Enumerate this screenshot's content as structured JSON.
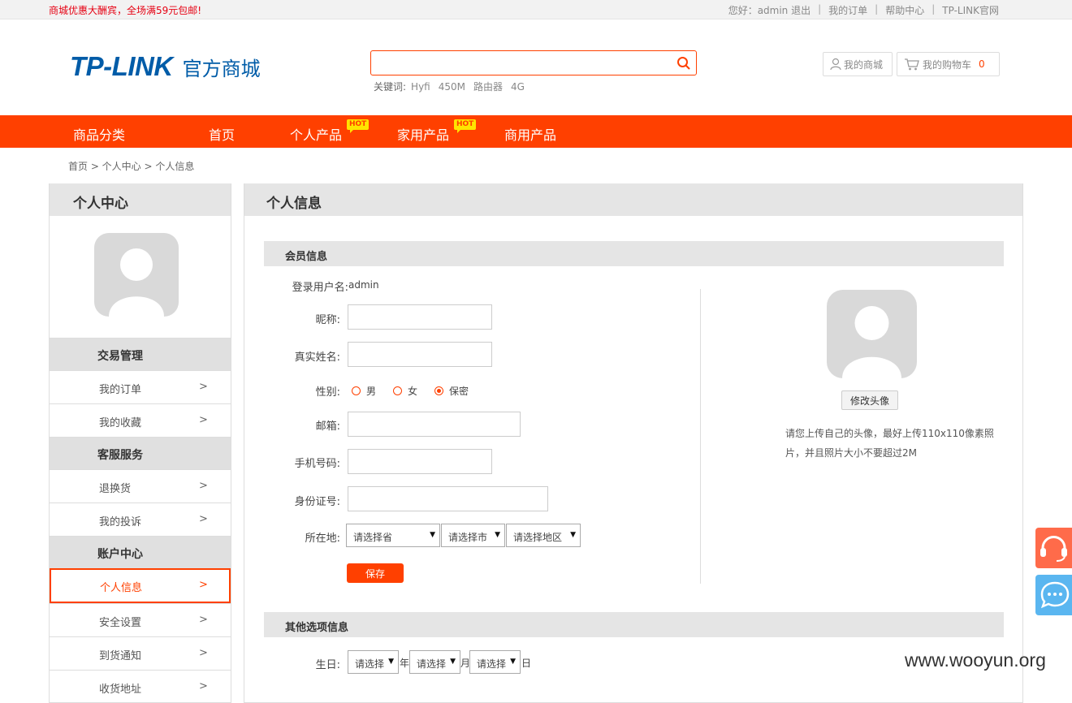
{
  "topbar": {
    "promo": "商城优惠大酬宾，全场满59元包邮!",
    "greeting": "您好：admin 退出",
    "links": [
      "我的订单",
      "帮助中心",
      "TP-LINK官网"
    ]
  },
  "header": {
    "logo_brand": "TP-LINK",
    "logo_sub": "官方商城",
    "search_value": "",
    "keywords_label": "关键词:",
    "keywords": [
      "Hyfi",
      "450M",
      "路由器",
      "4G"
    ],
    "my_mall": "我的商城",
    "cart_label": "我的购物车",
    "cart_count": "0"
  },
  "nav": {
    "items": [
      "商品分类",
      "首页",
      "个人产品",
      "家用产品",
      "商用产品"
    ],
    "hot_label": "HOT"
  },
  "breadcrumb": "首页 > 个人中心 > 个人信息",
  "sidebar": {
    "title": "个人中心",
    "arrow": ">",
    "sections": [
      {
        "title": "交易管理",
        "items": [
          "我的订单",
          "我的收藏"
        ]
      },
      {
        "title": "客服服务",
        "items": [
          "退换货",
          "我的投诉"
        ]
      },
      {
        "title": "账户中心",
        "items": [
          "个人信息",
          "安全设置",
          "到货通知",
          "收货地址"
        ]
      }
    ],
    "active_item": "个人信息"
  },
  "main": {
    "title": "个人信息",
    "member_section": "会员信息",
    "labels": {
      "username": "登录用户名:",
      "nickname": "昵称:",
      "realname": "真实姓名:",
      "gender": "性别:",
      "email": "邮箱:",
      "phone": "手机号码:",
      "idcard": "身份证号:",
      "location": "所在地:",
      "birthday": "生日:"
    },
    "username_value": "admin",
    "gender_options": [
      "男",
      "女",
      "保密"
    ],
    "gender_selected": "保密",
    "location_selects": [
      "请选择省",
      "请选择市",
      "请选择地区"
    ],
    "save_button": "保存",
    "change_avatar_button": "修改头像",
    "avatar_tip": "请您上传自己的头像，最好上传110x110像素照片，并且照片大小不要超过2M",
    "other_section": "其他选项信息",
    "birthday_selects": [
      "请选择",
      "请选择",
      "请选择"
    ],
    "birthday_units": [
      "年",
      "月",
      "日"
    ]
  },
  "watermark": "www.wooyun.org",
  "colors": {
    "accent": "#ff4000",
    "brand": "#005ca8",
    "float_top": "#ff6b4a",
    "float_bottom": "#5ab6f0"
  }
}
